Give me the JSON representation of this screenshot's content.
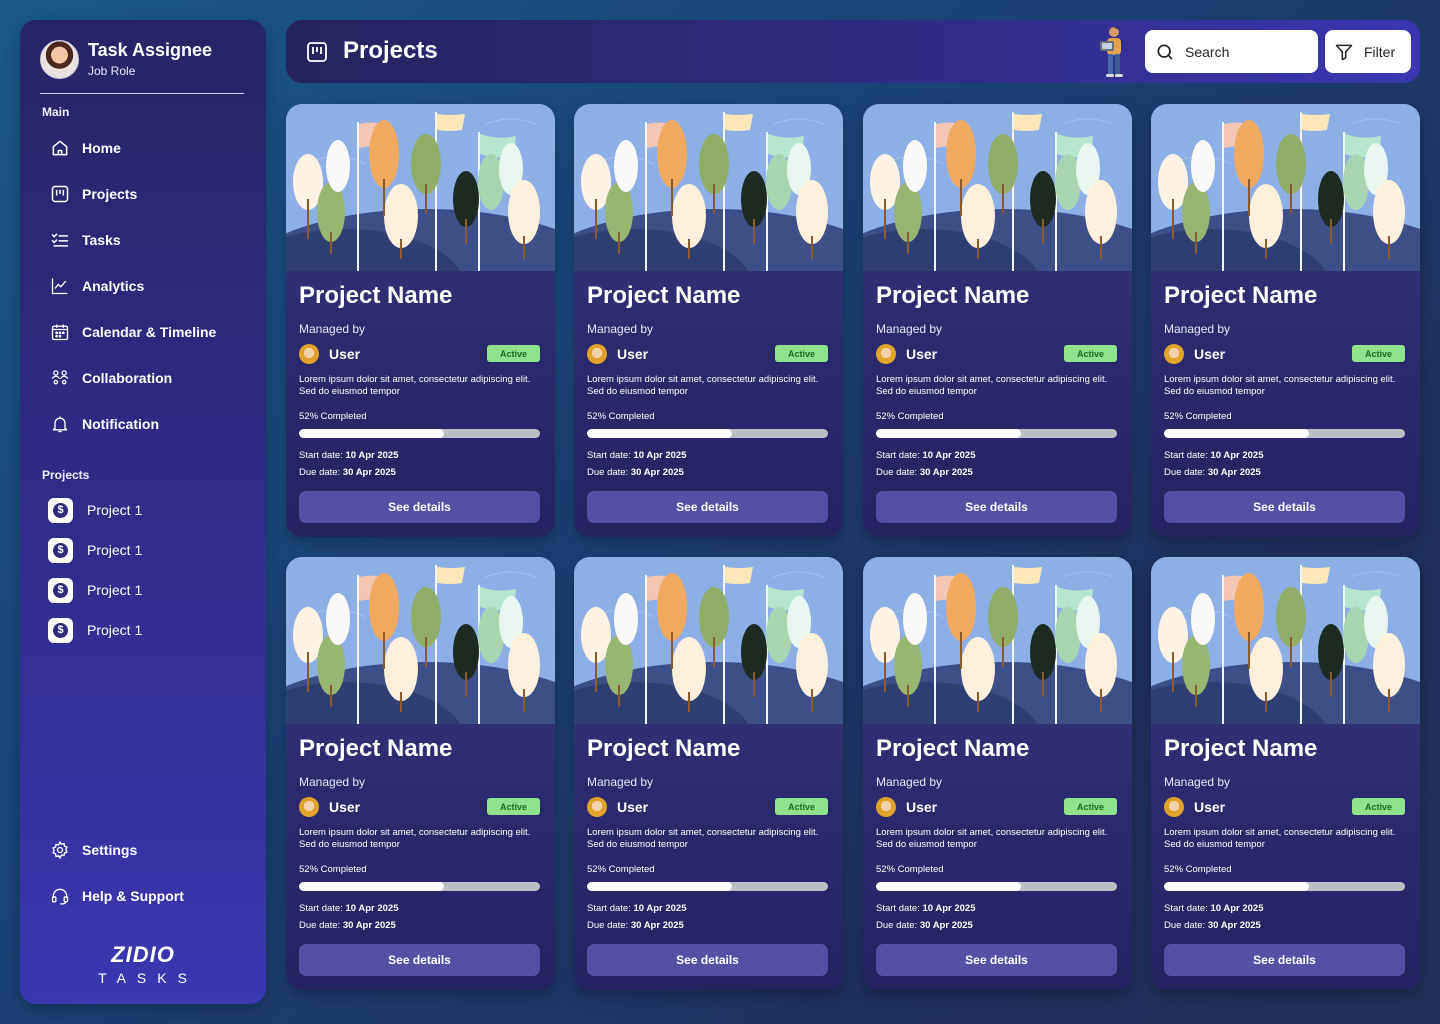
{
  "profile": {
    "name": "Task Assignee",
    "role": "Job Role"
  },
  "sidebar": {
    "main_label": "Main",
    "items": [
      {
        "label": "Home",
        "icon": "home-icon"
      },
      {
        "label": "Projects",
        "icon": "projects-icon"
      },
      {
        "label": "Tasks",
        "icon": "tasks-icon"
      },
      {
        "label": "Analytics",
        "icon": "analytics-icon"
      },
      {
        "label": "Calendar & Timeline",
        "icon": "calendar-icon"
      },
      {
        "label": "Collaboration",
        "icon": "collaboration-icon"
      },
      {
        "label": "Notification",
        "icon": "bell-icon"
      }
    ],
    "projects_label": "Projects",
    "projects": [
      "Project 1",
      "Project 1",
      "Project 1",
      "Project 1"
    ],
    "bottom_items": [
      {
        "label": "Settings",
        "icon": "gear-icon"
      },
      {
        "label": "Help & Support",
        "icon": "headset-icon"
      }
    ]
  },
  "brand": {
    "top": "ZIDIO",
    "bottom": "TASKS"
  },
  "header": {
    "title": "Projects",
    "search_placeholder": "Search",
    "filter_label": "Filter"
  },
  "colors": {
    "status_bg": "#8fe38c",
    "status_text": "#1d6b1d",
    "button_bg": "#5450a5"
  },
  "cards": [
    {
      "title": "Project Name",
      "managed_label": "Managed by",
      "user": "User",
      "status": "Active",
      "description": "Lorem ipsum dolor sit amet, consectetur adipiscing elit. Sed do eiusmod tempor",
      "progress_label": "52% Completed",
      "progress": 0.6,
      "start_label": "Start date:",
      "start_date": "10 Apr 2025",
      "due_label": "Due date:",
      "due_date": "30 Apr 2025",
      "button": "See details"
    },
    {
      "title": "Project Name",
      "managed_label": "Managed by",
      "user": "User",
      "status": "Active",
      "description": "Lorem ipsum dolor sit amet, consectetur adipiscing elit. Sed do eiusmod tempor",
      "progress_label": "52% Completed",
      "progress": 0.6,
      "start_label": "Start date:",
      "start_date": "10 Apr 2025",
      "due_label": "Due date:",
      "due_date": "30 Apr 2025",
      "button": "See details"
    },
    {
      "title": "Project Name",
      "managed_label": "Managed by",
      "user": "User",
      "status": "Active",
      "description": "Lorem ipsum dolor sit amet, consectetur adipiscing elit. Sed do eiusmod tempor",
      "progress_label": "52% Completed",
      "progress": 0.6,
      "start_label": "Start date:",
      "start_date": "10 Apr 2025",
      "due_label": "Due date:",
      "due_date": "30 Apr 2025",
      "button": "See details"
    },
    {
      "title": "Project Name",
      "managed_label": "Managed by",
      "user": "User",
      "status": "Active",
      "description": "Lorem ipsum dolor sit amet, consectetur adipiscing elit. Sed do eiusmod tempor",
      "progress_label": "52% Completed",
      "progress": 0.6,
      "start_label": "Start date:",
      "start_date": "10 Apr 2025",
      "due_label": "Due date:",
      "due_date": "30 Apr 2025",
      "button": "See details"
    },
    {
      "title": "Project Name",
      "managed_label": "Managed by",
      "user": "User",
      "status": "Active",
      "description": "Lorem ipsum dolor sit amet, consectetur adipiscing elit. Sed do eiusmod tempor",
      "progress_label": "52% Completed",
      "progress": 0.6,
      "start_label": "Start date:",
      "start_date": "10 Apr 2025",
      "due_label": "Due date:",
      "due_date": "30 Apr 2025",
      "button": "See details"
    },
    {
      "title": "Project Name",
      "managed_label": "Managed by",
      "user": "User",
      "status": "Active",
      "description": "Lorem ipsum dolor sit amet, consectetur adipiscing elit. Sed do eiusmod tempor",
      "progress_label": "52% Completed",
      "progress": 0.6,
      "start_label": "Start date:",
      "start_date": "10 Apr 2025",
      "due_label": "Due date:",
      "due_date": "30 Apr 2025",
      "button": "See details"
    },
    {
      "title": "Project Name",
      "managed_label": "Managed by",
      "user": "User",
      "status": "Active",
      "description": "Lorem ipsum dolor sit amet, consectetur adipiscing elit. Sed do eiusmod tempor",
      "progress_label": "52% Completed",
      "progress": 0.6,
      "start_label": "Start date:",
      "start_date": "10 Apr 2025",
      "due_label": "Due date:",
      "due_date": "30 Apr 2025",
      "button": "See details"
    },
    {
      "title": "Project Name",
      "managed_label": "Managed by",
      "user": "User",
      "status": "Active",
      "description": "Lorem ipsum dolor sit amet, consectetur adipiscing elit. Sed do eiusmod tempor",
      "progress_label": "52% Completed",
      "progress": 0.6,
      "start_label": "Start date:",
      "start_date": "10 Apr 2025",
      "due_label": "Due date:",
      "due_date": "30 Apr 2025",
      "button": "See details"
    }
  ]
}
